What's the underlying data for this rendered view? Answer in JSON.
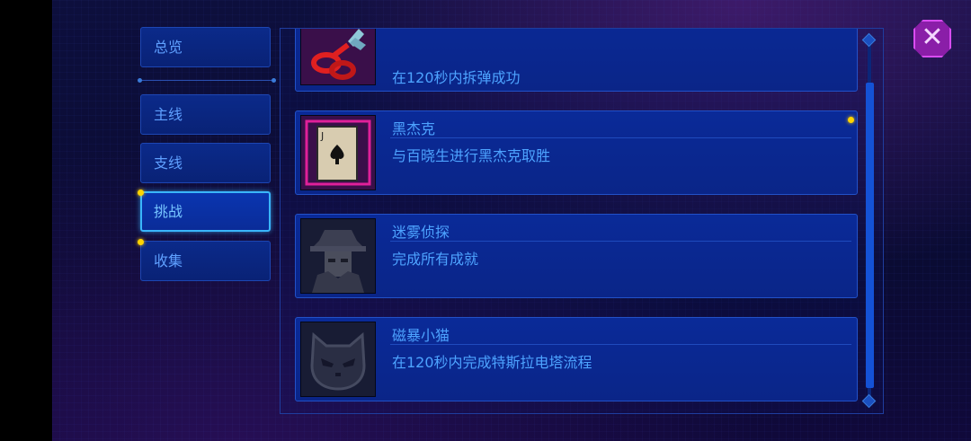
{
  "tabs": [
    {
      "label": "总览"
    },
    {
      "label": "主线"
    },
    {
      "label": "支线"
    },
    {
      "label": "挑战"
    },
    {
      "label": "收集"
    }
  ],
  "active_tab": "挑战",
  "achievements": [
    {
      "title": "",
      "desc": "在120秒内拆弹成功",
      "icon": "wire-cutter-icon"
    },
    {
      "title": "黑杰克",
      "desc": "与百晓生进行黑杰克取胜",
      "icon": "spade-jack-card-icon"
    },
    {
      "title": "迷雾侦探",
      "desc": "完成所有成就",
      "icon": "detective-icon"
    },
    {
      "title": "磁暴小猫",
      "desc": "在120秒内完成特斯拉电塔流程",
      "icon": "cat-icon"
    }
  ],
  "colors": {
    "accent": "#3ab6ff",
    "text": "#4da3ff",
    "notify_dot": "#ffd400",
    "close": "#8a1ea8"
  }
}
